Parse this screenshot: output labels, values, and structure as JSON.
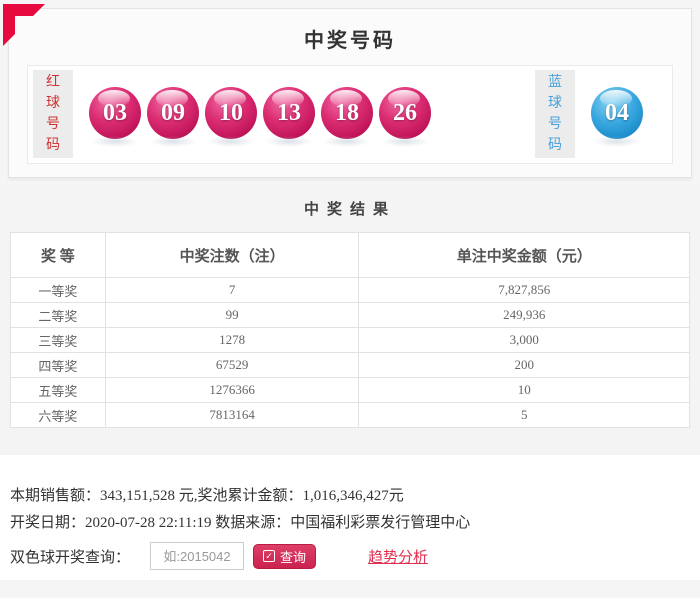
{
  "winning_numbers": {
    "title": "中奖号码",
    "red_label": "红球号码",
    "blue_label": "蓝球号码",
    "red_balls": [
      "03",
      "09",
      "10",
      "13",
      "18",
      "26"
    ],
    "blue_ball": "04"
  },
  "results": {
    "title": "中奖结果",
    "columns": [
      "奖 等",
      "中奖注数（注）",
      "单注中奖金额（元）"
    ],
    "rows": [
      {
        "level": "一等奖",
        "count": "7",
        "amount": "7,827,856"
      },
      {
        "level": "二等奖",
        "count": "99",
        "amount": "249,936"
      },
      {
        "level": "三等奖",
        "count": "1278",
        "amount": "3,000"
      },
      {
        "level": "四等奖",
        "count": "67529",
        "amount": "200"
      },
      {
        "level": "五等奖",
        "count": "1276366",
        "amount": "10"
      },
      {
        "level": "六等奖",
        "count": "7813164",
        "amount": "5"
      }
    ]
  },
  "footer": {
    "sales_line": "本期销售额：343,151,528 元,奖池累计金额：1,016,346,427元",
    "date_line": "开奖日期：2020-07-28 22:11:19 数据来源：中国福利彩票发行管理中心",
    "query_label": "双色球开奖查询：",
    "input_placeholder": "如:2015042",
    "query_button_label": "查询",
    "check_icon_glyph": "✓",
    "trend_link_label": "趋势分析"
  },
  "colors": {
    "corner_red": "#e60a3e",
    "red_ball": "#d42a72",
    "blue_ball": "#2d9fd8",
    "red_label_text": "#cc3333",
    "blue_label_text": "#4aa0d8",
    "query_button_bg": "#cb2250",
    "trend_link": "#e03050",
    "section_bg": "#f4f4f4"
  }
}
